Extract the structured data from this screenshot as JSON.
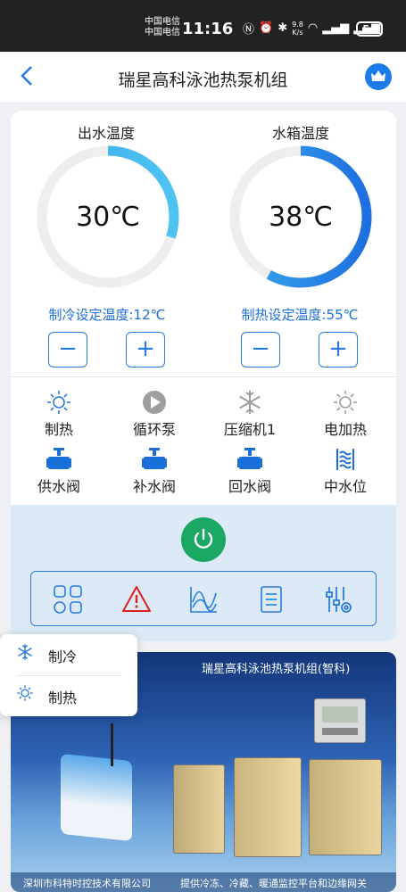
{
  "status_bar": {
    "carrier_1": "中国电信",
    "carrier_2": "中国电信",
    "time": "11:16",
    "net_speed_value": "9.8",
    "net_speed_unit": "K/s",
    "battery": "54"
  },
  "header": {
    "title": "瑞星高科泳池热泵机组",
    "back_icon": "back-chevron-icon",
    "crown_icon": "crown-icon"
  },
  "gauges": [
    {
      "label": "出水温度",
      "value": "30℃",
      "level": 0.3,
      "color": "#4fc3f0"
    },
    {
      "label": "水箱温度",
      "value": "38℃",
      "level": 0.58,
      "color": "#1e6fe0"
    }
  ],
  "setpoints": {
    "cooling": "制冷设定温度:12℃",
    "heating": "制热设定温度:55℃",
    "minus": "−",
    "plus": "+"
  },
  "status_row_1": [
    {
      "label": "制热",
      "icon": "sun-icon"
    },
    {
      "label": "循环泵",
      "icon": "pump-play-icon"
    },
    {
      "label": "压缩机1",
      "icon": "snowflake-icon"
    },
    {
      "label": "电加热",
      "icon": "sun-icon"
    }
  ],
  "status_row_2": [
    {
      "label": "供水阀",
      "icon": "valve-icon"
    },
    {
      "label": "补水阀",
      "icon": "valve-icon"
    },
    {
      "label": "回水阀",
      "icon": "valve-icon"
    },
    {
      "label": "中水位",
      "icon": "water-level-icon"
    }
  ],
  "toolbar": [
    "grid-apps-icon",
    "alarm-warning-icon",
    "curve-chart-icon",
    "list-document-icon",
    "settings-sliders-icon"
  ],
  "popup": {
    "cool_label": "制冷",
    "heat_label": "制热"
  },
  "banner": {
    "title": "瑞星高科泳池热泵机组(智科)",
    "footer_left": "深圳市科特时控技术有限公司",
    "footer_right": "提供冷冻、冷藏、暖通监控平台和边缘网关"
  },
  "colors": {
    "accent": "#2a7be0",
    "power": "#1aa864",
    "alarm": "#e02020",
    "panel": "#dbeaf6"
  }
}
